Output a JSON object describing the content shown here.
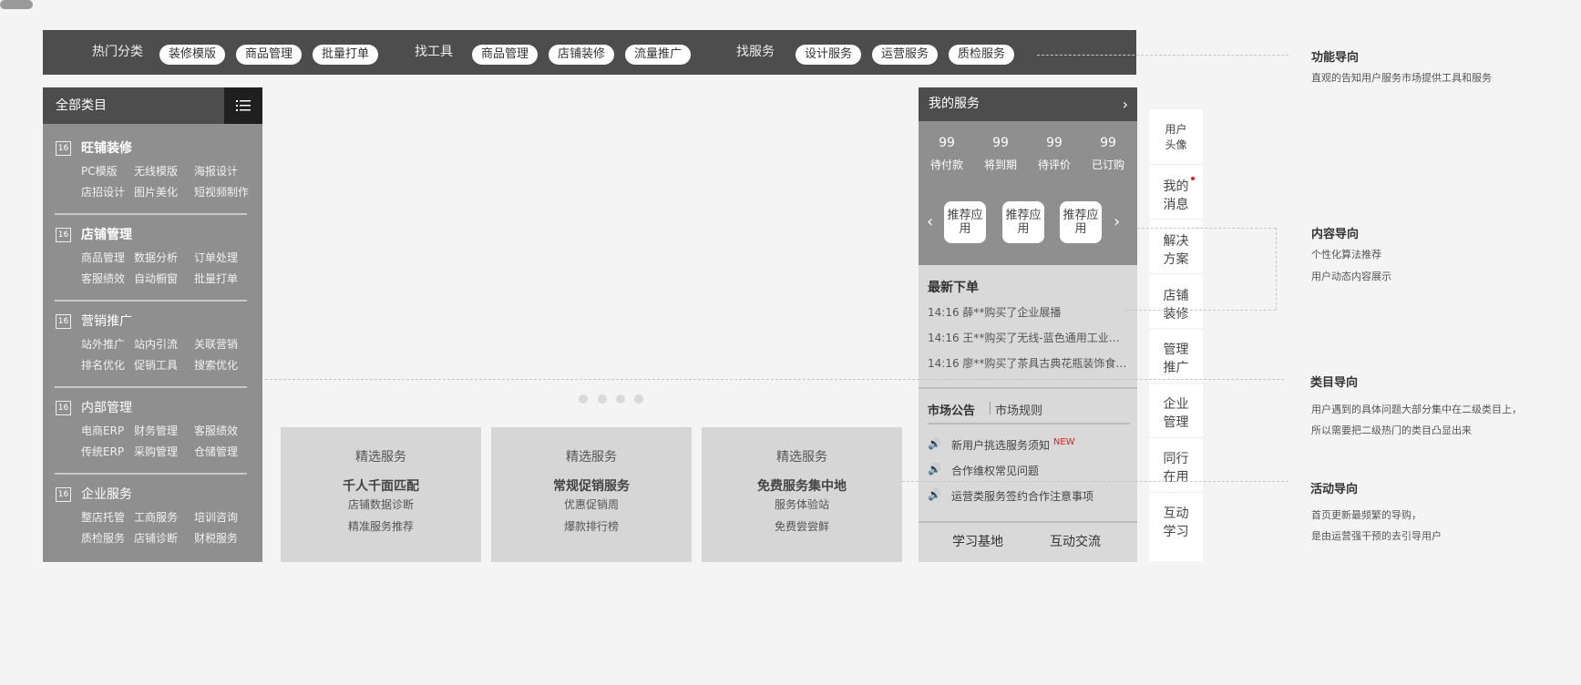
{
  "topbar": {
    "hot_label": "热门分类",
    "hot_pills": [
      "装修模版",
      "商品管理",
      "批量打单"
    ],
    "tools_label": "找工具",
    "tools_pills": [
      "商品管理",
      "店铺装修",
      "流量推广"
    ],
    "service_label": "找服务",
    "service_pills": [
      "设计服务",
      "运营服务",
      "质检服务"
    ]
  },
  "categories": {
    "title": "全部类目",
    "icon_text": "16",
    "groups": [
      {
        "title": "旺铺装修",
        "row1": [
          "PC模版",
          "无线模版",
          "海报设计"
        ],
        "row2": [
          "店招设计",
          "图片美化",
          "短视频制作"
        ]
      },
      {
        "title": "店铺管理",
        "row1": [
          "商品管理",
          "数据分析",
          "订单处理"
        ],
        "row2": [
          "客服绩效",
          "自动橱窗",
          "批量打单"
        ]
      },
      {
        "title": "营销推广",
        "row1": [
          "站外推广",
          "站内引流",
          "关联营销"
        ],
        "row2": [
          "排名优化",
          "促销工具",
          "搜索优化"
        ]
      },
      {
        "title": "内部管理",
        "row1": [
          "电商ERP",
          "财务管理",
          "客服绩效"
        ],
        "row2": [
          "传统ERP",
          "采购管理",
          "仓储管理"
        ]
      },
      {
        "title": "企业服务",
        "row1": [
          "整店托管",
          "工商服务",
          "培训咨询"
        ],
        "row2": [
          "质检服务",
          "店铺诊断",
          "财税服务"
        ]
      }
    ]
  },
  "cards": [
    {
      "tag": "精选服务",
      "title": "千人千面匹配",
      "line1": "店铺数据诊断",
      "line2": "精准服务推荐"
    },
    {
      "tag": "精选服务",
      "title": "常规促销服务",
      "line1": "优惠促销周",
      "line2": "爆款排行榜"
    },
    {
      "tag": "精选服务",
      "title": "免费服务集中地",
      "line1": "服务体验站",
      "line2": "免费尝尝鲜"
    }
  ],
  "service": {
    "title": "我的服务",
    "arrow": "›",
    "stats": [
      {
        "num": "99",
        "label": "待付款"
      },
      {
        "num": "99",
        "label": "将到期"
      },
      {
        "num": "99",
        "label": "待评价"
      },
      {
        "num": "99",
        "label": "已订购"
      }
    ],
    "recommend": [
      "推荐应用",
      "推荐应用",
      "推荐应用"
    ],
    "prev": "‹",
    "next": "›",
    "orders_title": "最新下单",
    "orders": [
      "14:16  薛**购买了企业展播",
      "14:16  王**购买了无线-蓝色通用工业品...",
      "14:16  廖**购买了茶具古典花瓶装饰食品..."
    ],
    "tab_notice": "市场公告",
    "tab_rules": "市场规则",
    "notices": [
      "新用户挑选服务须知",
      "合作维权常见问题",
      "运营类服务签约合作注意事项"
    ],
    "new_badge": "NEW",
    "speaker": "🔊",
    "foot": [
      "学习基地",
      "互动交流"
    ]
  },
  "right_nav": {
    "avatar": "用户头像",
    "items": [
      "我的消息",
      "解决方案",
      "店铺装修",
      "管理推广",
      "企业管理",
      "同行在用",
      "互动学习"
    ]
  },
  "annotations": [
    {
      "title": "功能导向",
      "lines": [
        "直观的告知用户服务市场提供工具和服务"
      ]
    },
    {
      "title": "内容导向",
      "lines": [
        "个性化算法推荐",
        "用户动态内容展示"
      ]
    },
    {
      "title": "类目导向",
      "lines": [
        "用户遇到的具体问题大部分集中在二级类目上，",
        "所以需要把二级热门的类目凸显出来"
      ]
    },
    {
      "title": "活动导向",
      "lines": [
        "首页更新最频繁的导购，",
        "是由运营强干预的去引导用户"
      ]
    }
  ]
}
